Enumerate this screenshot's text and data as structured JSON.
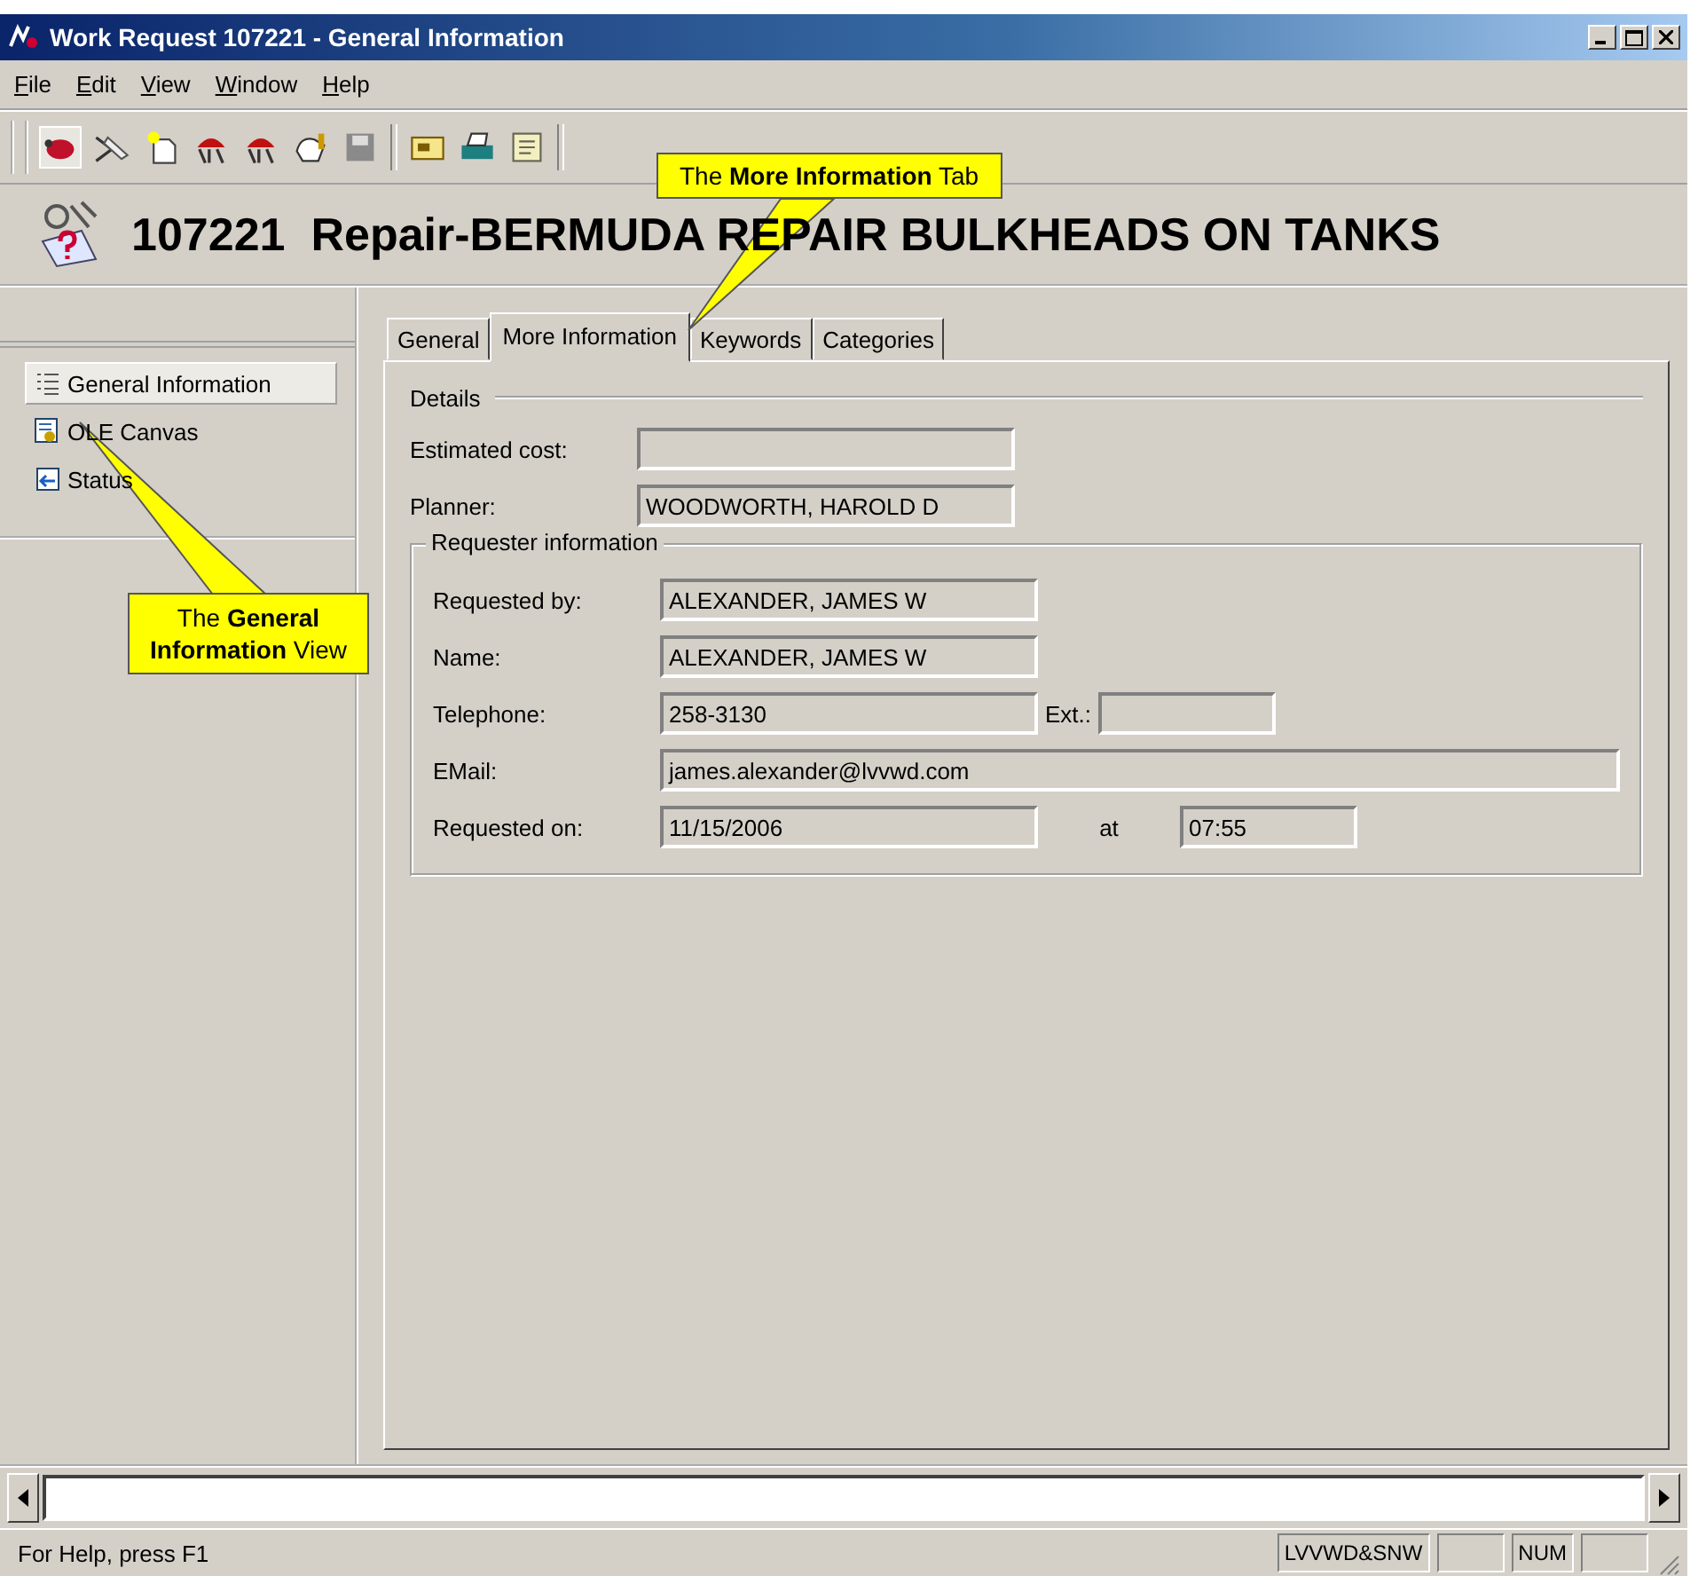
{
  "window": {
    "title": "Work Request 107221 - General Information"
  },
  "menu": [
    {
      "label": "File"
    },
    {
      "label": "Edit"
    },
    {
      "label": "View"
    },
    {
      "label": "Window"
    },
    {
      "label": "Help"
    }
  ],
  "heading": "107221  Repair-BERMUDA REPAIR BULKHEADS ON TANKS",
  "sidebar": {
    "items": [
      {
        "label": "General Information",
        "selected": true,
        "kind": "list"
      },
      {
        "label": "OLE Canvas",
        "selected": false,
        "kind": "canvas"
      },
      {
        "label": "Status",
        "selected": false,
        "kind": "status"
      }
    ]
  },
  "tabs": [
    {
      "label": "General",
      "selected": false
    },
    {
      "label": "More Information",
      "selected": true
    },
    {
      "label": "Keywords",
      "selected": false
    },
    {
      "label": "Categories",
      "selected": false
    }
  ],
  "details": {
    "title": "Details",
    "fields": [
      {
        "label": "Estimated cost:"
      },
      {
        "label": "Planner:",
        "value": "WOODWORTH, HAROLD D"
      }
    ]
  },
  "requester": {
    "title": "Requester information",
    "rows": [
      {
        "kind": "short",
        "label": "Requested by:",
        "value": "ALEXANDER, JAMES W"
      },
      {
        "kind": "short",
        "label": "Name:",
        "value": "ALEXANDER, JAMES W"
      },
      {
        "kind": "pair",
        "label": "Telephone:",
        "value": "258-3130",
        "extra_label": "Ext.:"
      },
      {
        "kind": "wide",
        "label": "EMail:",
        "value": "james.alexander@lvvwd.com"
      },
      {
        "kind": "joined",
        "label": "Requested on:",
        "value": "11/15/2006",
        "extra_label": "at",
        "extra_value": "07:55"
      }
    ]
  },
  "callouts": [
    {
      "kind": "tab",
      "text": "The **More Information** Tab"
    },
    {
      "kind": "view",
      "text": "The **General Information** View"
    }
  ],
  "status_bar": {
    "help": "For Help, press F1",
    "panes": [
      "LVVWD&SNW",
      "NUM"
    ]
  }
}
